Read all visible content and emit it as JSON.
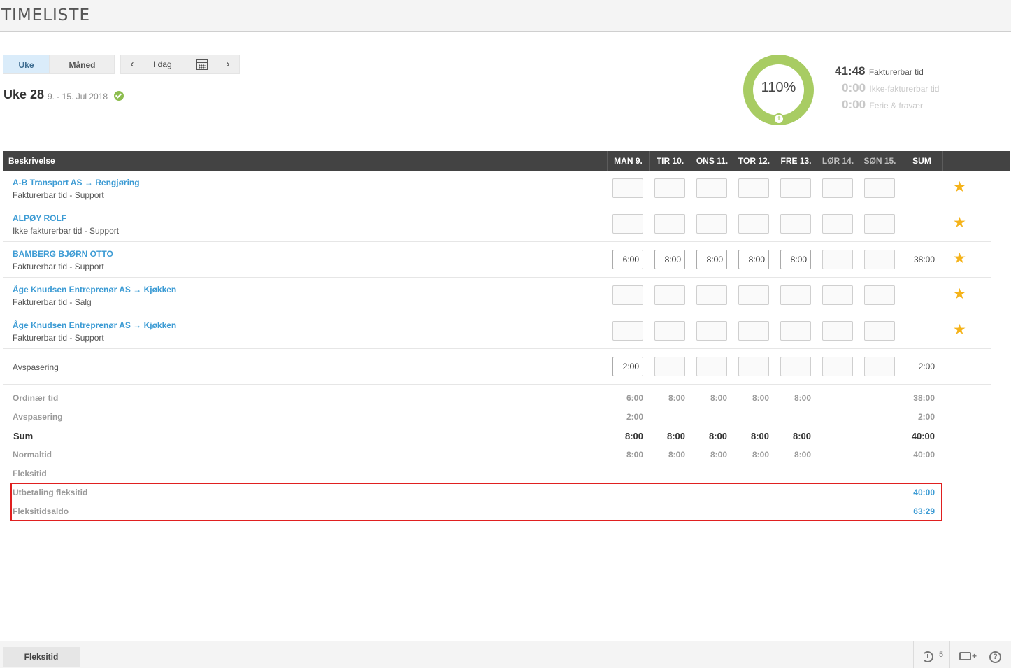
{
  "header": {
    "title": "TIMELISTE"
  },
  "view_toggle": {
    "week": "Uke",
    "month": "Måned"
  },
  "nav": {
    "prev": "‹",
    "today": "I dag",
    "next": "›",
    "calendar_icon": "calendar-icon"
  },
  "week": {
    "label": "Uke 28",
    "range": "9. - 15. Jul 2018",
    "status_icon": "check-circle-icon"
  },
  "summary": {
    "percent": "110%",
    "billable_value": "41:48",
    "billable_label": "Fakturerbar tid",
    "nonbillable_value": "0:00",
    "nonbillable_label": "Ikke-fakturerbar tid",
    "leave_value": "0:00",
    "leave_label": "Ferie & fravær",
    "donut_color": "#a8cc63"
  },
  "table": {
    "columns": {
      "description": "Beskrivelse",
      "sum": "SUM"
    },
    "days": [
      "MAN 9.",
      "TIR 10.",
      "ONS 11.",
      "TOR 12.",
      "FRE 13.",
      "LØR 14.",
      "SØN 15."
    ],
    "rows": [
      {
        "title": "A-B Transport AS → Rengjøring",
        "subtitle": "Fakturerbar tid - Support",
        "values": [
          "",
          "",
          "",
          "",
          "",
          "",
          ""
        ],
        "sum": ""
      },
      {
        "title": "ALPØY ROLF",
        "subtitle": "Ikke fakturerbar tid - Support",
        "values": [
          "",
          "",
          "",
          "",
          "",
          "",
          ""
        ],
        "sum": ""
      },
      {
        "title": "BAMBERG BJØRN OTTO",
        "subtitle": "Fakturerbar tid - Support",
        "values": [
          "6:00",
          "8:00",
          "8:00",
          "8:00",
          "8:00",
          "",
          ""
        ],
        "sum": "38:00"
      },
      {
        "title": "Åge Knudsen Entreprenør AS → Kjøkken",
        "subtitle": "Fakturerbar tid - Salg",
        "values": [
          "",
          "",
          "",
          "",
          "",
          "",
          ""
        ],
        "sum": ""
      },
      {
        "title": "Åge Knudsen Entreprenør AS → Kjøkken",
        "subtitle": "Fakturerbar tid - Support",
        "values": [
          "",
          "",
          "",
          "",
          "",
          "",
          ""
        ],
        "sum": ""
      }
    ],
    "comp_row": {
      "label": "Avspasering",
      "values": [
        "2:00",
        "",
        "",
        "",
        "",
        "",
        ""
      ],
      "sum": "2:00"
    }
  },
  "totals": {
    "ordinary": {
      "label": "Ordinær tid",
      "values": [
        "6:00",
        "8:00",
        "8:00",
        "8:00",
        "8:00",
        "",
        ""
      ],
      "sum": "38:00"
    },
    "comp": {
      "label": "Avspasering",
      "values": [
        "2:00",
        "",
        "",
        "",
        "",
        "",
        ""
      ],
      "sum": "2:00"
    },
    "sum": {
      "label": "Sum",
      "values": [
        "8:00",
        "8:00",
        "8:00",
        "8:00",
        "8:00",
        "",
        ""
      ],
      "sum": "40:00"
    },
    "normal": {
      "label": "Normaltid",
      "values": [
        "8:00",
        "8:00",
        "8:00",
        "8:00",
        "8:00",
        "",
        ""
      ],
      "sum": "40:00"
    },
    "flex": {
      "label": "Fleksitid",
      "values": [
        "",
        "",
        "",
        "",
        "",
        "",
        ""
      ],
      "sum": ""
    },
    "flex_payout": {
      "label": "Utbetaling fleksitid",
      "sum": "40:00"
    },
    "flex_balance": {
      "label": "Fleksitidsaldo",
      "sum": "63:29"
    }
  },
  "footer": {
    "tab": "Fleksitid",
    "history_count": "5"
  },
  "colors": {
    "accent_blue": "#3c9bd4",
    "star": "#f5b31a",
    "highlight": "#e02020",
    "header_bg": "#434343"
  }
}
